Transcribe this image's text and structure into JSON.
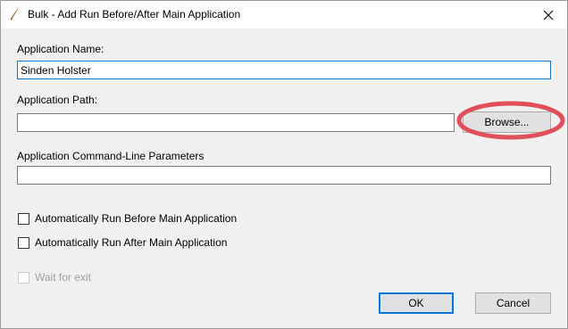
{
  "window": {
    "title": "Bulk - Add Run Before/After Main Application",
    "close_icon": "close-icon",
    "app_icon": "pen-icon"
  },
  "form": {
    "app_name_label": "Application Name:",
    "app_name_value": "Sinden Holster",
    "app_path_label": "Application Path:",
    "app_path_value": "",
    "browse_label": "Browse...",
    "params_label": "Application Command-Line Parameters",
    "params_value": ""
  },
  "options": {
    "run_before_label": "Automatically Run Before Main Application",
    "run_before_checked": false,
    "run_after_label": "Automatically Run After Main Application",
    "run_after_checked": false,
    "wait_label": "Wait for exit",
    "wait_checked": false,
    "wait_enabled": false
  },
  "buttons": {
    "ok_label": "OK",
    "cancel_label": "Cancel"
  },
  "annotation": {
    "highlight_color": "#e0505a"
  }
}
